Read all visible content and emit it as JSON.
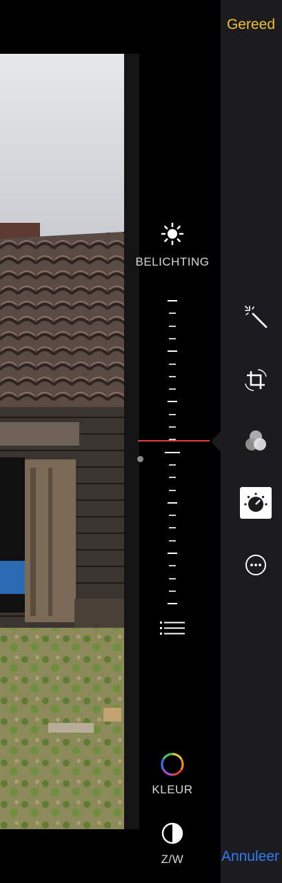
{
  "header": {
    "done_label": "Gereed"
  },
  "footer": {
    "cancel_label": "Annuleer"
  },
  "adjustments": {
    "light": {
      "label": "BELICHTING",
      "icon": "sun-icon"
    },
    "list": {
      "icon": "list-icon"
    },
    "color": {
      "label": "KLEUR",
      "icon": "color-wheel-icon"
    },
    "bw": {
      "label": "Z/W",
      "icon": "contrast-icon"
    }
  },
  "toolbar": {
    "tools": [
      "magic-wand-icon",
      "crop-rotate-icon",
      "filters-icon",
      "adjust-dial-icon",
      "more-icon"
    ],
    "selected": "adjust-dial-icon"
  },
  "colors": {
    "done": "#f0c230",
    "cancel": "#2f7cf6",
    "indicator": "#e0413a",
    "panel": "#1c1c1e"
  }
}
